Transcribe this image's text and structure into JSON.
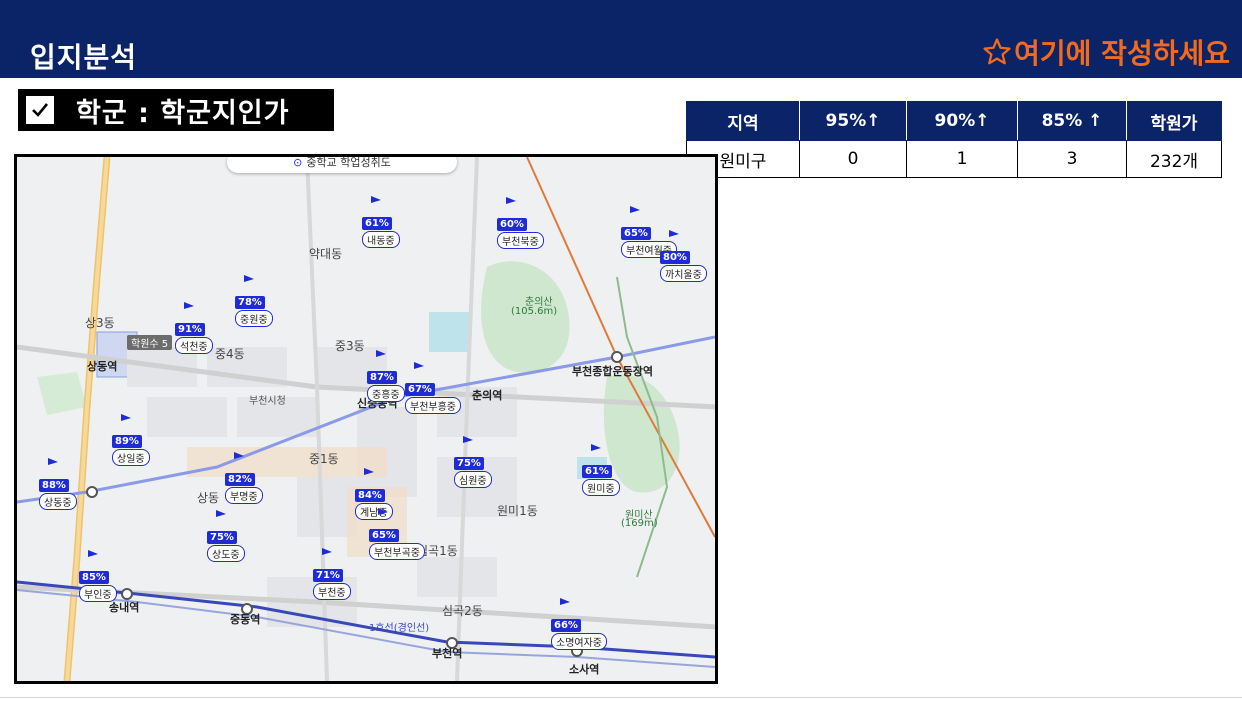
{
  "header": {
    "title": "입지분석",
    "action_label": "여기에 작성하세요",
    "accent_color": "#f26a1b",
    "bar_color": "#0b2468"
  },
  "section": {
    "label": "학군 : 학군지인가",
    "icon": "check-icon"
  },
  "table": {
    "headers": [
      "지역",
      "95%↑",
      "90%↑",
      "85% ↑",
      "학원가"
    ],
    "rows": [
      [
        "원미구",
        "0",
        "1",
        "3",
        "232개"
      ]
    ]
  },
  "map": {
    "search_text": "중학교 학업성취도",
    "schools": [
      {
        "pct": "61%",
        "name": "내동중"
      },
      {
        "pct": "60%",
        "name": "부천북중"
      },
      {
        "pct": "65%",
        "name": "부천여월중"
      },
      {
        "pct": "80%",
        "name": "까치울중"
      },
      {
        "pct": "78%",
        "name": "중원중"
      },
      {
        "pct": "91%",
        "name": "석천중"
      },
      {
        "pct": "87%",
        "name": "중흥중"
      },
      {
        "pct": "67%",
        "name": "부천부흥중"
      },
      {
        "pct": "89%",
        "name": "상일중"
      },
      {
        "pct": "88%",
        "name": "상동중"
      },
      {
        "pct": "82%",
        "name": "부명중"
      },
      {
        "pct": "84%",
        "name": "계남중"
      },
      {
        "pct": "75%",
        "name": "심원중"
      },
      {
        "pct": "61%",
        "name": "원미중"
      },
      {
        "pct": "65%",
        "name": "부천부곡중"
      },
      {
        "pct": "75%",
        "name": "상도중"
      },
      {
        "pct": "71%",
        "name": "부천중"
      },
      {
        "pct": "85%",
        "name": "부인중"
      },
      {
        "pct": "66%",
        "name": "소명여자중"
      }
    ],
    "labels": {
      "yakdae": "약대동",
      "jung4": "중4동",
      "jung3": "중3동",
      "jung1": "중1동",
      "sang3": "상3동",
      "sangdong": "상동",
      "sangdong_st": "상동역",
      "sinjung_st": "신중동역",
      "chunui_st": "춘의역",
      "bucheon_st": "부천역",
      "songnae_st": "송내역",
      "jungdong_st": "중동역",
      "sosa_st": "소사역",
      "stadium_st": "부천종합운동장역",
      "wonmi1": "원미1동",
      "simgok1": "심곡1동",
      "simgok2": "심곡2동",
      "chunuisan": "춘의산",
      "chunuisan_h": "(105.6m)",
      "wonmisan": "원미산",
      "wonmisan_h": "(169m)",
      "cityhall": "부천시청",
      "line1": "1호선(경인선)",
      "academy_count": "학원수 5"
    }
  }
}
